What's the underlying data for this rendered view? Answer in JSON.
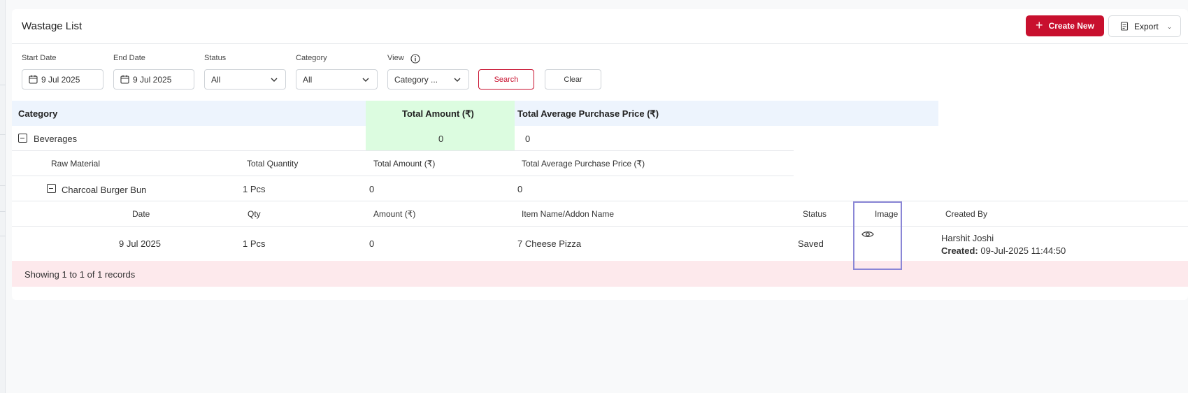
{
  "page": {
    "title": "Wastage List"
  },
  "actions": {
    "create_label": "Create New",
    "export_label": "Export"
  },
  "filters": {
    "start_date": {
      "label": "Start Date",
      "value": "9 Jul 2025"
    },
    "end_date": {
      "label": "End Date",
      "value": "9 Jul 2025"
    },
    "status": {
      "label": "Status",
      "value": "All"
    },
    "category": {
      "label": "Category",
      "value": "All"
    },
    "view": {
      "label": "View",
      "value": "Category ..."
    },
    "search_label": "Search",
    "clear_label": "Clear"
  },
  "table": {
    "headers": {
      "category": "Category",
      "total_amount": "Total Amount (₹)",
      "avg_price": "Total Average Purchase Price (₹)"
    },
    "category_row": {
      "name": "Beverages",
      "total_amount": "0",
      "avg_price": "0"
    },
    "raw_headers": {
      "raw_material": "Raw Material",
      "total_quantity": "Total Quantity",
      "total_amount": "Total Amount (₹)",
      "avg_price": "Total Average Purchase Price (₹)"
    },
    "raw_row": {
      "name": "Charcoal Burger Bun",
      "quantity": "1 Pcs",
      "total_amount": "0",
      "avg_price": "0"
    },
    "detail_headers": {
      "date": "Date",
      "qty": "Qty",
      "amount": "Amount (₹)",
      "item_name": "Item Name/Addon Name",
      "status": "Status",
      "image": "Image",
      "created_by": "Created By"
    },
    "detail_row": {
      "date": "9 Jul 2025",
      "qty": "1 Pcs",
      "amount": "0",
      "item_name": "7 Cheese Pizza",
      "status": "Saved",
      "created_by_name": "Harshit Joshi",
      "created_label": "Created:",
      "created_at": "09-Jul-2025 11:44:50"
    },
    "footer": "Showing 1 to 1 of 1 records"
  },
  "colors": {
    "brand": "#c8102e",
    "header_bg": "#edf4fd",
    "amount_bg": "#dcfce0",
    "footer_bg": "#fde9ec",
    "highlight": "#8a86d6"
  },
  "icons": {
    "create": "plus-icon",
    "export": "document-icon",
    "date": "calendar-icon",
    "view_info": "info-icon",
    "expand": "minus-square-icon",
    "image": "eye-icon"
  }
}
